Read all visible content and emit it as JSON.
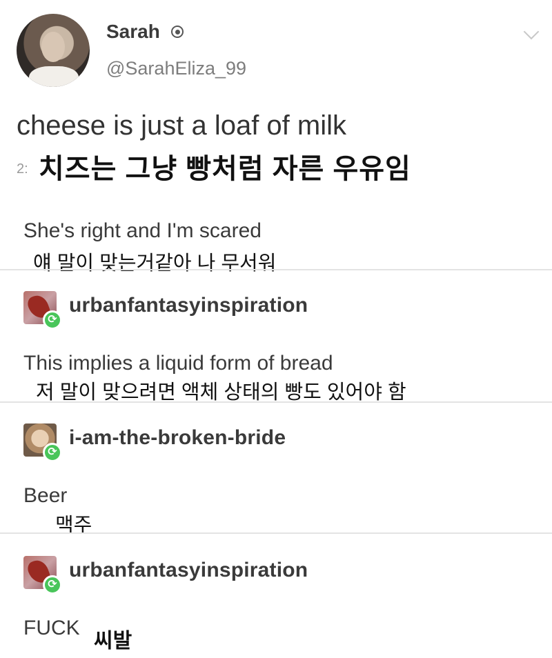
{
  "tweet": {
    "display_name": "Sarah",
    "handle": "@SarahEliza_99",
    "text": "cheese is just a loaf of milk",
    "timestamp_fragment": "2:",
    "translation": "치즈는 그냥 빵처럼 자른 우유임"
  },
  "posts": [
    {
      "text": "She's right and I'm scared",
      "translation": "얘 말이 맞는거같아 나 무서워"
    },
    {
      "blog_name": "urbanfantasyinspiration",
      "text": "This implies a liquid form of bread",
      "translation": "저 말이 맞으려면 액체 상태의 빵도 있어야 함"
    },
    {
      "blog_name": "i-am-the-broken-bride",
      "text": "Beer",
      "translation": "맥주"
    },
    {
      "blog_name": "urbanfantasyinspiration",
      "text": "FUCK",
      "translation": "씨발"
    }
  ],
  "icons": {
    "verified": "verified-icon",
    "menu": "chevron-down-icon",
    "reblog": "reblog-icon"
  },
  "colors": {
    "reblog_green": "#49c55a",
    "divider": "#e3e3e3",
    "handle_gray": "#7d7d7d"
  }
}
